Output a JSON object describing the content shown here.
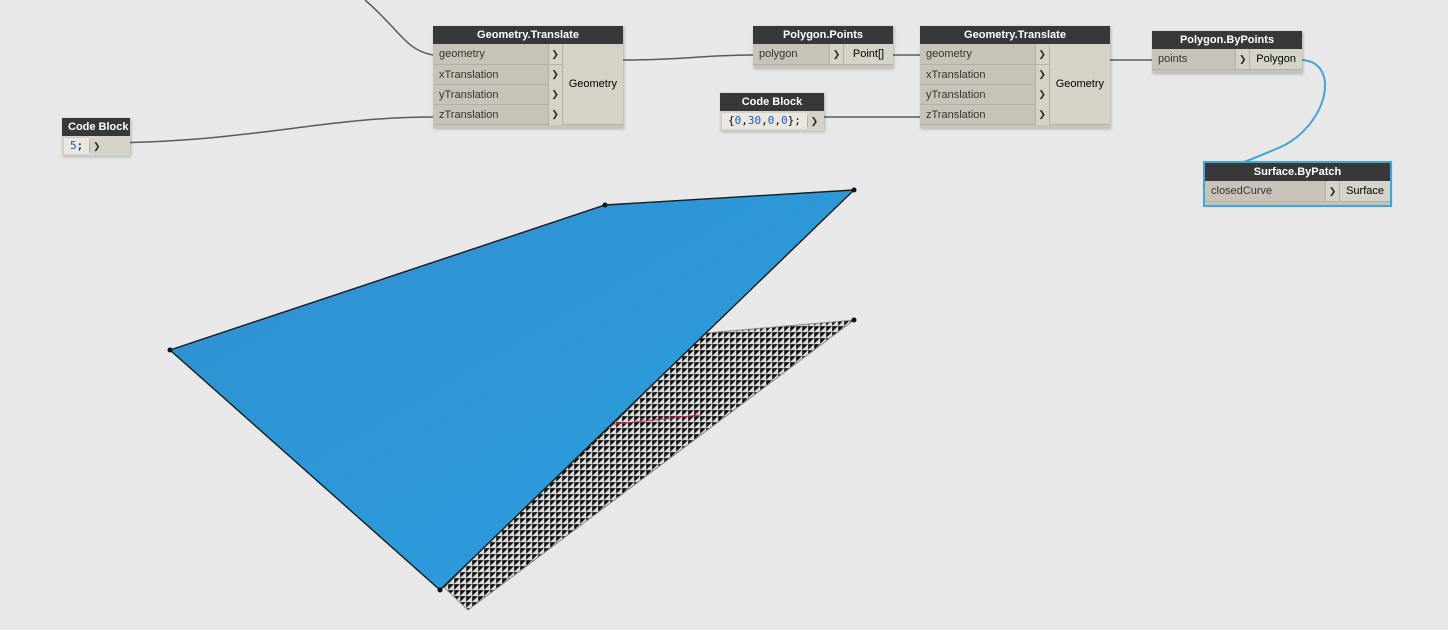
{
  "nodes": {
    "codeBlock1": {
      "title": "Code Block",
      "code_html": "<span class='num'>5</span>;"
    },
    "geomTranslate1": {
      "title": "Geometry.Translate",
      "inputs": [
        "geometry",
        "xTranslation",
        "yTranslation",
        "zTranslation"
      ],
      "output": "Geometry"
    },
    "polygonPoints": {
      "title": "Polygon.Points",
      "inputs": [
        "polygon"
      ],
      "output": "Point[]"
    },
    "codeBlock2": {
      "title": "Code Block",
      "code_html": "{<span class='num'>0</span>,<span class='num'>30</span>,<span class='num'>0</span>,<span class='num'>0</span>};"
    },
    "geomTranslate2": {
      "title": "Geometry.Translate",
      "inputs": [
        "geometry",
        "xTranslation",
        "yTranslation",
        "zTranslation"
      ],
      "output": "Geometry"
    },
    "polygonByPoints": {
      "title": "Polygon.ByPoints",
      "inputs": [
        "points"
      ],
      "output": "Polygon"
    },
    "surfaceByPatch": {
      "title": "Surface.ByPatch",
      "inputs": [
        "closedCurve"
      ],
      "output": "Surface"
    }
  }
}
